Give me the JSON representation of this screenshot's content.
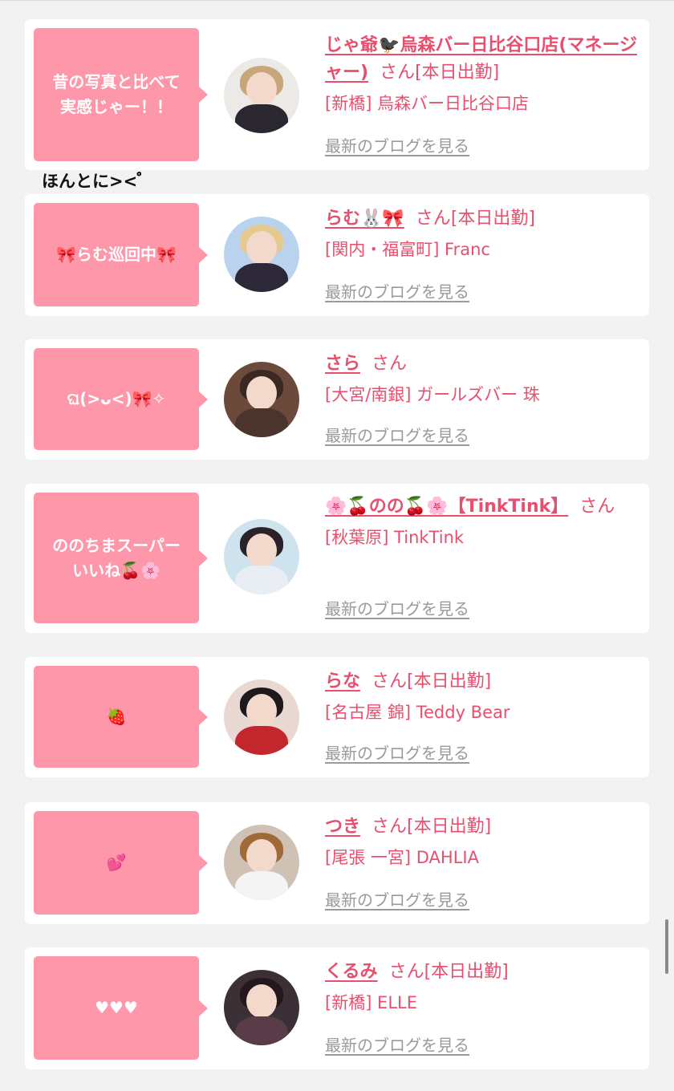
{
  "colors": {
    "background": "#f2f2f2",
    "card": "#ffffff",
    "bubble": "#ff97ab",
    "accent": "#e84f6f",
    "link_gray": "#9a9a9a"
  },
  "blog_link_label": "最新のブログを見る",
  "note_between": "ほんとに>< ゚゚",
  "entries": [
    {
      "bubble": "昔の写真と比べて\n実感じゃー！！",
      "name": "じゃ爺🐦‍⬛烏森バー日比谷口店(マネージャー)",
      "san": "さん",
      "status": "[本日出勤]",
      "shop": "[新橋] 烏森バー日比谷口店",
      "avatar_icon": "avatar-man-in-suit-icon"
    },
    {
      "bubble": "🎀らむ巡回中🎀",
      "name": "らむ🐰🎀",
      "san": "さん",
      "status": "[本日出勤]",
      "shop": "[関内・福富町] Franc",
      "avatar_icon": "avatar-blonde-girl-icon"
    },
    {
      "bubble": "ଘ(>ᴗ<)🎀✧",
      "name": "さら",
      "san": "さん",
      "status": "",
      "shop": "[大宮/南銀] ガールズバー 珠",
      "avatar_icon": "avatar-cat-filter-girl-icon"
    },
    {
      "bubble": "ののちまスーパー\nいいね🍒🌸",
      "name": "🌸🍒のの🍒🌸【TinkTink】",
      "san": "さん",
      "status": "",
      "shop": "[秋葉原] TinkTink",
      "avatar_icon": "avatar-idol-girl-icon"
    },
    {
      "bubble": "🍓",
      "name": "らな",
      "san": "さん",
      "status": "[本日出勤]",
      "shop": "[名古屋 錦] Teddy Bear",
      "avatar_icon": "avatar-girl-red-outfit-icon"
    },
    {
      "bubble": "💕",
      "name": "つき",
      "san": "さん",
      "status": "[本日出勤]",
      "shop": "[尾張 一宮] DAHLIA",
      "avatar_icon": "avatar-dog-filter-girl-icon"
    },
    {
      "bubble": "♥︎♥︎♥︎",
      "name": "くるみ",
      "san": "さん",
      "status": "[本日出勤]",
      "shop": "[新橋] ELLE",
      "avatar_icon": "avatar-cat-ear-girl-icon"
    }
  ]
}
